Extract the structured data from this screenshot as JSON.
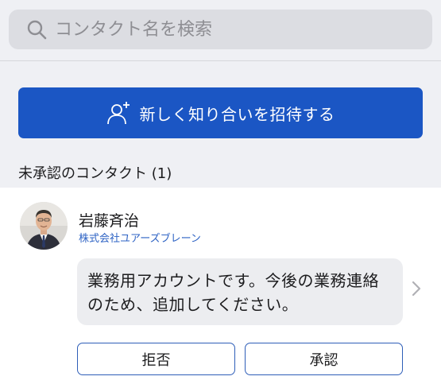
{
  "search": {
    "placeholder": "コンタクト名を検索",
    "icon": "search-icon"
  },
  "invite": {
    "label": "新しく知り合いを招待する",
    "icon": "add-person-icon",
    "color": "#1b56c4"
  },
  "pending_section": {
    "title": "未承認のコンタクト (1)"
  },
  "contact": {
    "name": "岩藤斉治",
    "company": "株式会社ユアーズブレーン",
    "message": "業務用アカウントです。今後の業務連絡のため、追加してください。",
    "avatar": "avatar-photo"
  },
  "actions": {
    "reject_label": "拒否",
    "approve_label": "承認"
  },
  "colors": {
    "accent": "#1b56c4",
    "company_text": "#2e63c4",
    "background": "#eff0f4"
  }
}
